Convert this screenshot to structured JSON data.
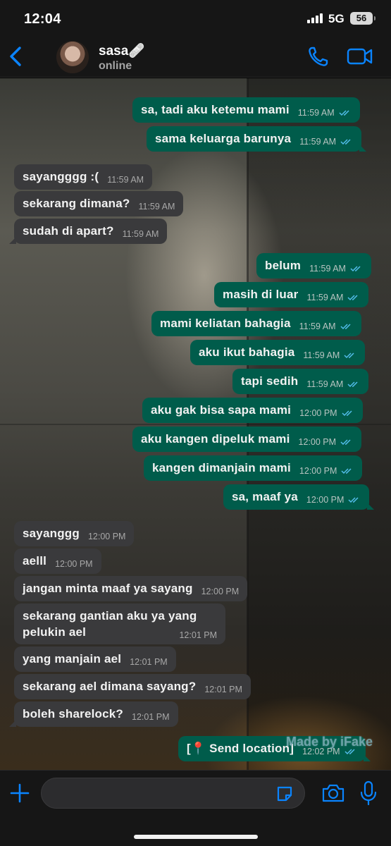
{
  "status_bar": {
    "time": "12:04",
    "network": "5G",
    "battery": "56"
  },
  "header": {
    "name": "sasa🩹",
    "status": "online"
  },
  "accent_color": "#0a84ff",
  "outgoing_bubble_color": "#005c4b",
  "incoming_bubble_color": "#3a3a3c",
  "messages": [
    {
      "dir": "out",
      "text": "sa, tadi aku ketemu mami",
      "time": "11:59 AM"
    },
    {
      "dir": "out",
      "text": "sama keluarga barunya",
      "time": "11:59 AM"
    },
    {
      "dir": "in",
      "text": "sayangggg :(",
      "time": "11:59 AM"
    },
    {
      "dir": "in",
      "text": "sekarang dimana?",
      "time": "11:59 AM"
    },
    {
      "dir": "in",
      "text": "sudah di apart?",
      "time": "11:59 AM"
    },
    {
      "dir": "out",
      "text": "belum",
      "time": "11:59 AM"
    },
    {
      "dir": "out",
      "text": "masih di luar",
      "time": "11:59 AM"
    },
    {
      "dir": "out",
      "text": "mami keliatan bahagia",
      "time": "11:59 AM"
    },
    {
      "dir": "out",
      "text": "aku ikut bahagia",
      "time": "11:59 AM"
    },
    {
      "dir": "out",
      "text": "tapi sedih",
      "time": "11:59 AM"
    },
    {
      "dir": "out",
      "text": "aku gak bisa sapa mami",
      "time": "12:00 PM"
    },
    {
      "dir": "out",
      "text": "aku kangen dipeluk mami",
      "time": "12:00 PM"
    },
    {
      "dir": "out",
      "text": "kangen dimanjain mami",
      "time": "12:00 PM"
    },
    {
      "dir": "out",
      "text": "sa, maaf ya",
      "time": "12:00 PM"
    },
    {
      "dir": "in",
      "text": "sayanggg",
      "time": "12:00 PM"
    },
    {
      "dir": "in",
      "text": "aelll",
      "time": "12:00 PM"
    },
    {
      "dir": "in",
      "text": "jangan minta maaf ya sayang",
      "time": "12:00 PM"
    },
    {
      "dir": "in",
      "text": "sekarang gantian aku ya yang pelukin ael",
      "time": "12:01 PM"
    },
    {
      "dir": "in",
      "text": "yang manjain ael",
      "time": "12:01 PM"
    },
    {
      "dir": "in",
      "text": "sekarang ael dimana sayang?",
      "time": "12:01 PM"
    },
    {
      "dir": "in",
      "text": "boleh sharelock?",
      "time": "12:01 PM"
    },
    {
      "dir": "out",
      "text": "[📍 Send location]",
      "time": "12:02 PM"
    }
  ],
  "watermark": "Made by iFake",
  "icons": [
    "back-chevron-icon",
    "phone-icon",
    "video-camera-icon",
    "plus-icon",
    "sticker-icon",
    "camera-icon",
    "microphone-icon",
    "double-check-icon"
  ]
}
